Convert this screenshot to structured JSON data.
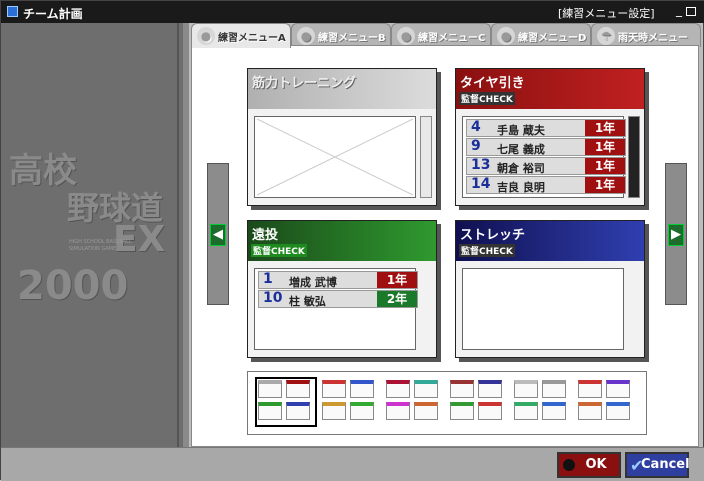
{
  "window": {
    "title": "チーム計画",
    "mode": "[練習メニュー設定]",
    "minimize": "_"
  },
  "logo": {
    "line1": "高校",
    "line2": "野球道",
    "line3": "EX",
    "line4": "2000",
    "sub": "HIGH SCHOOL BASEBALL SIMULATION GAME"
  },
  "tabs": [
    {
      "label": "練習メニューA",
      "active": true
    },
    {
      "label": "練習メニューB",
      "active": false
    },
    {
      "label": "練習メニューC",
      "active": false
    },
    {
      "label": "練習メニューD",
      "active": false
    },
    {
      "label": "雨天時メニュー",
      "active": false
    }
  ],
  "cards": [
    {
      "title": "筋力トレーニング",
      "check": "",
      "rows": []
    },
    {
      "title": "タイヤ引き",
      "check": "監督CHECK",
      "rows": [
        {
          "num": "4",
          "name": "手島 蔵夫",
          "grade": "1年"
        },
        {
          "num": "9",
          "name": "七尾 義成",
          "grade": "1年"
        },
        {
          "num": "13",
          "name": "朝倉 裕司",
          "grade": "1年"
        },
        {
          "num": "14",
          "name": "吉良 良明",
          "grade": "1年"
        }
      ]
    },
    {
      "title": "遠投",
      "check": "監督CHECK",
      "rows": [
        {
          "num": "1",
          "name": "増成 武博",
          "grade": "1年"
        },
        {
          "num": "10",
          "name": "柱 敏弘",
          "grade": "2年"
        }
      ]
    },
    {
      "title": "ストレッチ",
      "check": "監督CHECK",
      "rows": []
    }
  ],
  "nav": {
    "prev": "◀",
    "next": "▶"
  },
  "buttons": {
    "ok": "OK",
    "cancel": "Cancel"
  },
  "colors": {
    "grade1": "#a01010",
    "grade2": "#1a7a2a",
    "accent": "#2a6fd6"
  }
}
